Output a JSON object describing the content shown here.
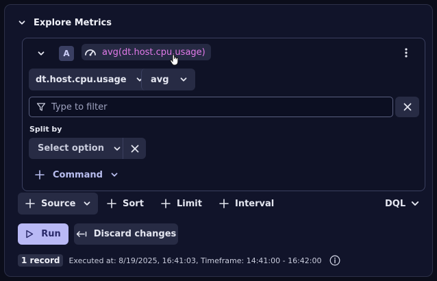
{
  "header": {
    "title": "Explore Metrics"
  },
  "query": {
    "letter": "A",
    "expression": "avg(dt.host.cpu.usage)",
    "metric_select": "dt.host.cpu.usage",
    "aggregation_select": "avg",
    "filter": {
      "placeholder": "Type to filter",
      "value": ""
    },
    "split_by": {
      "label": "Split by",
      "select_placeholder": "Select option"
    },
    "command_label": "Command"
  },
  "toolbar": {
    "source_label": "Source",
    "sort_label": "Sort",
    "limit_label": "Limit",
    "interval_label": "Interval",
    "dql_label": "DQL"
  },
  "actions": {
    "run_label": "Run",
    "discard_label": "Discard changes"
  },
  "status": {
    "record_count": "1 record",
    "executed": "Executed at: 8/19/2025, 16:41:03, Timeframe: 14:41:00 - 16:42:00"
  },
  "colors": {
    "accent_magenta": "#e27ae9",
    "run_button": "#b9b9f5",
    "panel_bg": "#11142a"
  }
}
